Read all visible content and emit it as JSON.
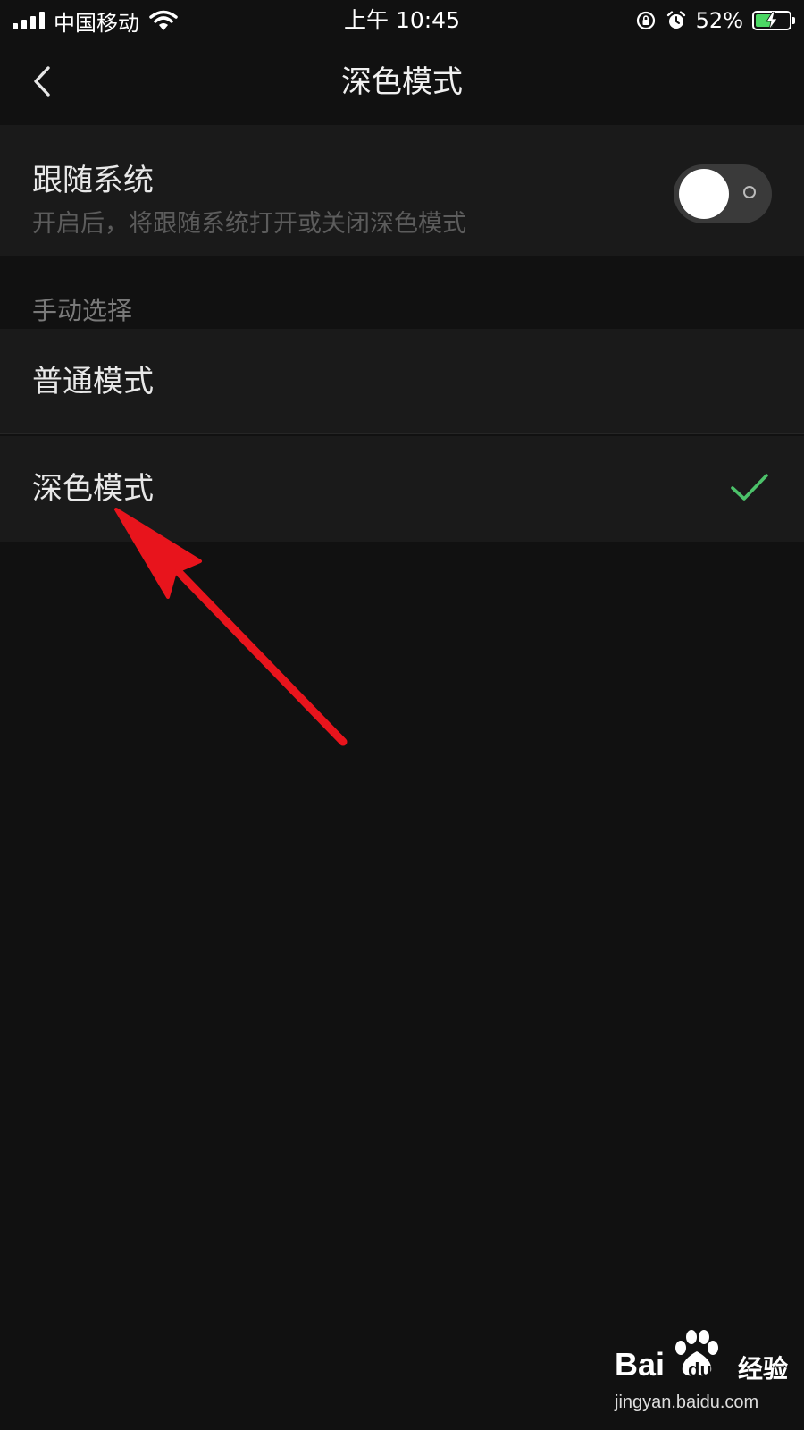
{
  "status_bar": {
    "carrier": "中国移动",
    "time": "上午 10:45",
    "battery_percent": "52%",
    "battery_level": 0.52,
    "icons": [
      "signal-icon",
      "wifi-icon",
      "rotation-lock-icon",
      "alarm-icon",
      "battery-charging-icon"
    ]
  },
  "nav": {
    "title": "深色模式",
    "back_icon": "chevron-left-icon"
  },
  "follow_system": {
    "title": "跟随系统",
    "description": "开启后，将跟随系统打开或关闭深色模式",
    "toggle_on": false
  },
  "manual": {
    "section_label": "手动选择",
    "options": [
      {
        "label": "普通模式",
        "selected": false
      },
      {
        "label": "深色模式",
        "selected": true
      }
    ]
  },
  "colors": {
    "background": "#111111",
    "cell": "#1a1a1a",
    "check": "#4cc26a",
    "annotation": "#e8141c"
  },
  "watermark": {
    "brand_bai": "Bai",
    "brand_du": "du",
    "brand_cn": "经验",
    "url": "jingyan.baidu.com"
  }
}
